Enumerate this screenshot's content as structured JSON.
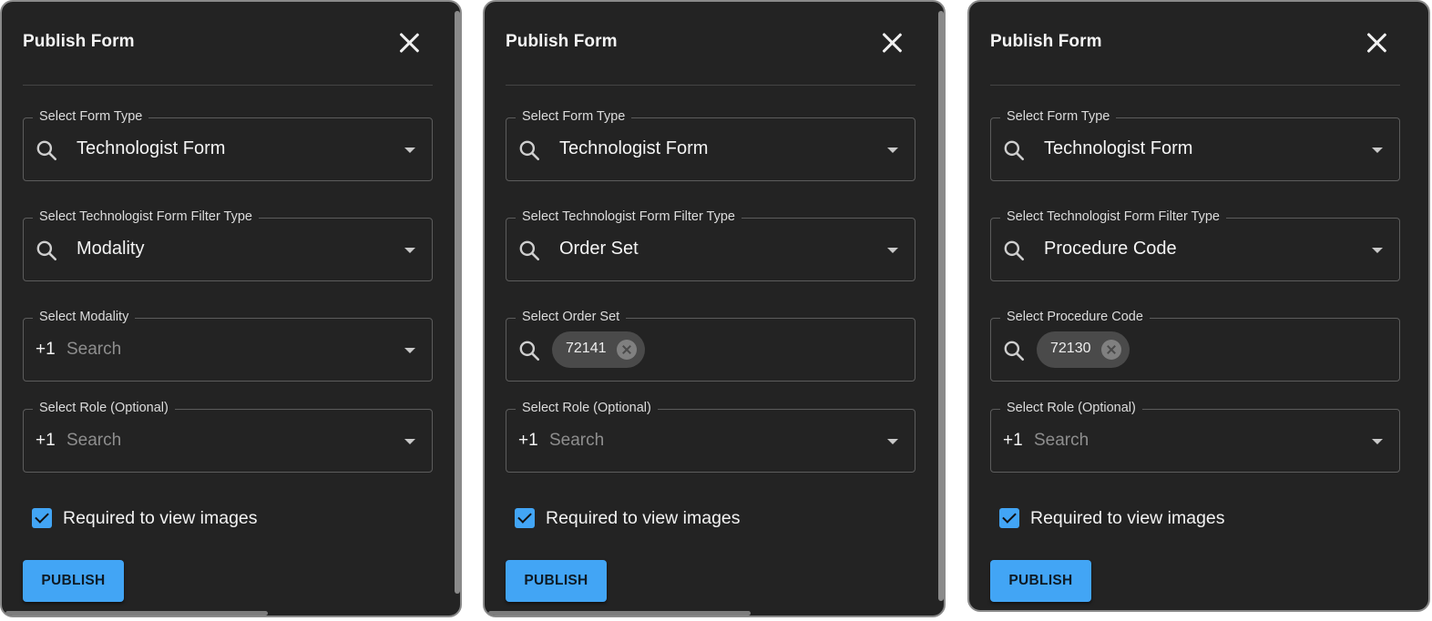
{
  "panels": [
    {
      "title": "Publish Form",
      "form_type": {
        "label": "Select Form Type",
        "value": "Technologist Form"
      },
      "filter_type": {
        "label": "Select Technologist Form Filter Type",
        "value": "Modality"
      },
      "filter_value": {
        "label": "Select Modality",
        "count": "+1",
        "placeholder": "Search"
      },
      "role": {
        "label": "Select Role (Optional)",
        "count": "+1",
        "placeholder": "Search"
      },
      "checkbox": {
        "label": "Required to view images",
        "checked": true
      },
      "publish_label": "PUBLISH"
    },
    {
      "title": "Publish Form",
      "form_type": {
        "label": "Select Form Type",
        "value": "Technologist Form"
      },
      "filter_type": {
        "label": "Select Technologist Form Filter Type",
        "value": "Order Set"
      },
      "filter_value": {
        "label": "Select Order Set",
        "chip": "72141"
      },
      "role": {
        "label": "Select Role (Optional)",
        "count": "+1",
        "placeholder": "Search"
      },
      "checkbox": {
        "label": "Required to view images",
        "checked": true
      },
      "publish_label": "PUBLISH"
    },
    {
      "title": "Publish Form",
      "form_type": {
        "label": "Select Form Type",
        "value": "Technologist Form"
      },
      "filter_type": {
        "label": "Select Technologist Form Filter Type",
        "value": "Procedure Code"
      },
      "filter_value": {
        "label": "Select Procedure Code",
        "chip": "72130"
      },
      "role": {
        "label": "Select Role (Optional)",
        "count": "+1",
        "placeholder": "Search"
      },
      "checkbox": {
        "label": "Required to view images",
        "checked": true
      },
      "publish_label": "PUBLISH"
    }
  ],
  "colors": {
    "dialog_bg": "#232323",
    "accent": "#42a5f5",
    "border": "#5c5c5c"
  },
  "icons": [
    "search-icon",
    "close-icon",
    "dropdown-arrow-icon",
    "chip-remove-icon",
    "checkbox-checked-icon"
  ]
}
